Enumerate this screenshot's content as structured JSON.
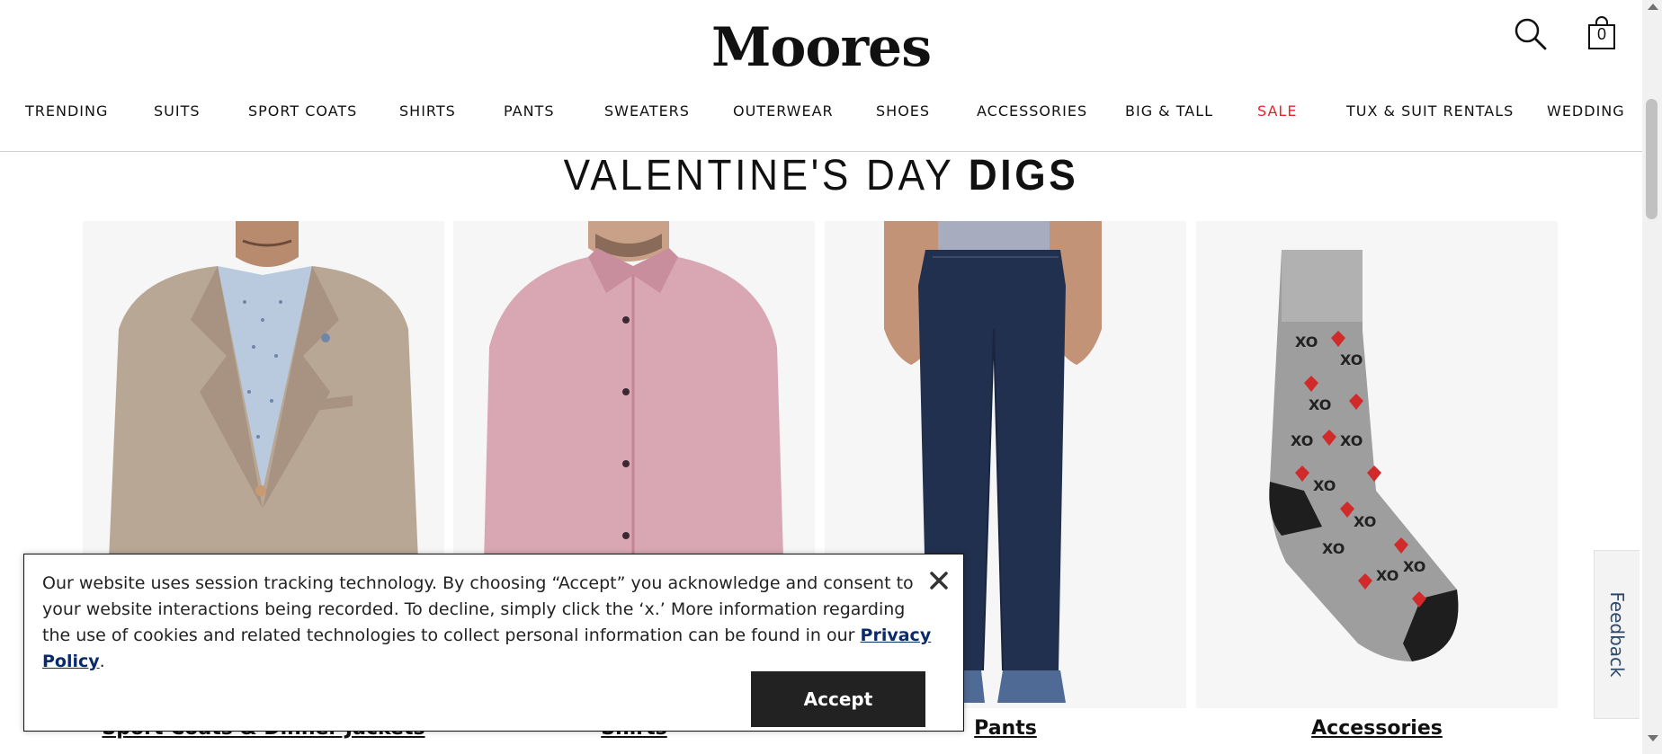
{
  "header": {
    "logo": "Moores",
    "cart_count": "0",
    "icons": {
      "search": "search-icon",
      "cart": "shopping-bag-icon"
    }
  },
  "nav": {
    "items": [
      {
        "label": "TRENDING"
      },
      {
        "label": "SUITS"
      },
      {
        "label": "SPORT COATS"
      },
      {
        "label": "SHIRTS"
      },
      {
        "label": "PANTS"
      },
      {
        "label": "SWEATERS"
      },
      {
        "label": "OUTERWEAR"
      },
      {
        "label": "SHOES"
      },
      {
        "label": "ACCESSORIES"
      },
      {
        "label": "BIG & TALL"
      },
      {
        "label": "SALE"
      },
      {
        "label": "TUX & SUIT RENTALS"
      },
      {
        "label": "WEDDING"
      }
    ],
    "sale_color": "#e5252a"
  },
  "hero": {
    "title_light": "VALENTINE'S DAY",
    "title_bold": "DIGS"
  },
  "categories": [
    {
      "label": "Sport Coats & Dinner Jackets",
      "image": "man-in-tan-sport-coat"
    },
    {
      "label": "Shirts",
      "image": "man-in-pink-dress-shirt"
    },
    {
      "label": "Pants",
      "image": "dark-denim-jeans"
    },
    {
      "label": "Accessories",
      "image": "grey-xo-heart-sock"
    }
  ],
  "feedback": {
    "label": "Feedback"
  },
  "cookie_banner": {
    "text_before": "Our website uses session tracking technology. By choosing “Accept” you acknowledge and consent to your website interactions being recorded. To decline, simply click the ‘x.’ More information regarding the use of cookies and related technologies to collect personal information can be found in our ",
    "link": "Privacy Policy",
    "text_after": ".",
    "accept": "Accept",
    "close_icon": "close-icon"
  }
}
